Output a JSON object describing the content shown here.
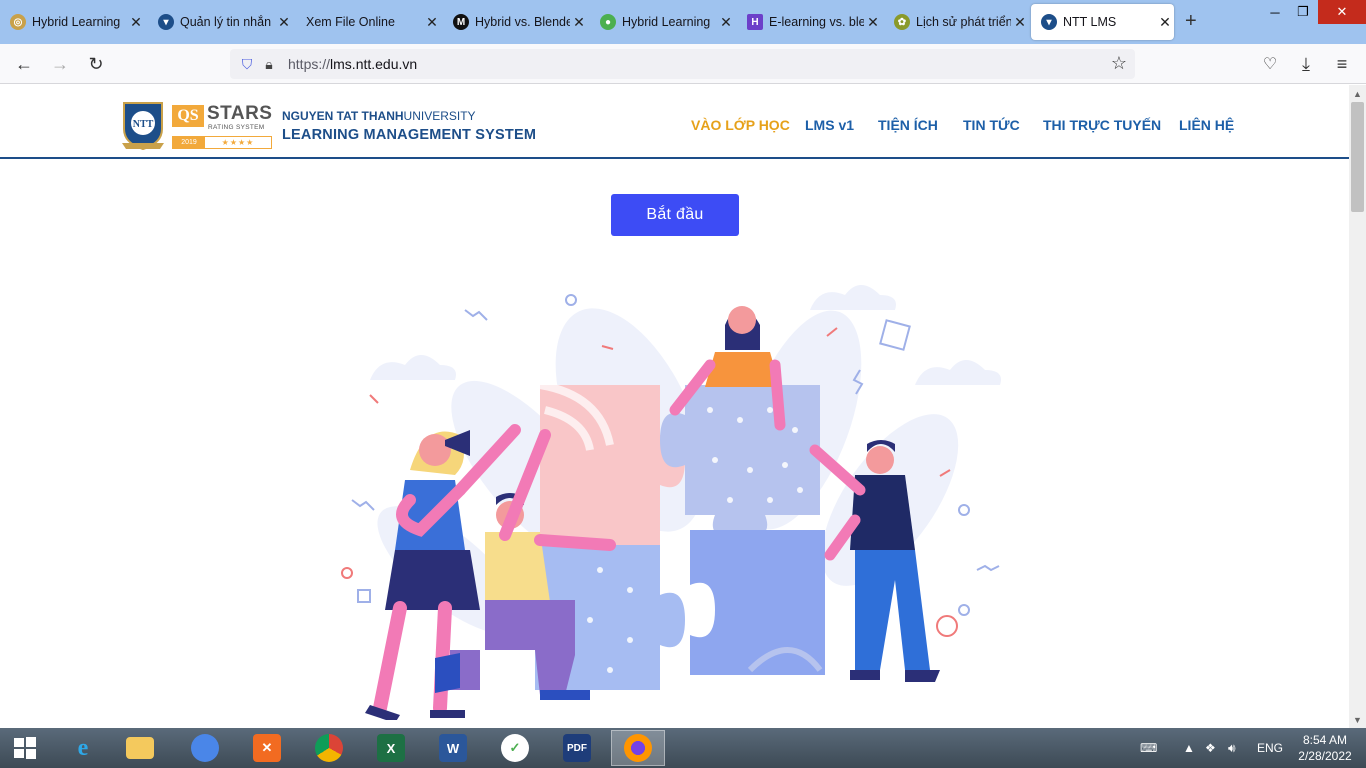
{
  "browser": {
    "tabs": [
      {
        "title": "Hybrid Learning",
        "icon": "globe-icon",
        "color": "#c9a14a"
      },
      {
        "title": "Quản lý tin nhắn",
        "icon": "ntt-shield-icon",
        "color": "#1d4e89"
      },
      {
        "title": "Xem File Online",
        "icon": "none",
        "color": ""
      },
      {
        "title": "Hybrid vs. Blended",
        "icon": "medium-icon",
        "color": "#111111"
      },
      {
        "title": "Hybrid Learning",
        "icon": "bulb-icon",
        "color": "#4caf50"
      },
      {
        "title": "E-learning vs. ble",
        "icon": "h-icon",
        "color": "#6c3fc9"
      },
      {
        "title": "Lịch sử phát triển",
        "icon": "seal-icon",
        "color": "#8a9a2a"
      },
      {
        "title": "NTT LMS",
        "icon": "ntt-shield-icon",
        "color": "#1d4e89"
      }
    ],
    "url": "https://lms.ntt.edu.vn",
    "url_host": "lms.ntt.edu.vn",
    "url_scheme": "https://"
  },
  "site": {
    "university": "NGUYEN TAT THANH",
    "university_suffix": "UNIVERSITY",
    "system": "LEARNING MANAGEMENT SYSTEM",
    "qs": {
      "q": "QS",
      "stars": "STARS",
      "rating": "RATING SYSTEM",
      "year": "2019",
      "star_row": "★★★★"
    },
    "logo_text": "NTT",
    "menu": [
      {
        "label": "VÀO LỚP HỌC",
        "active": true
      },
      {
        "label": "LMS v1",
        "active": false
      },
      {
        "label": "TIỆN ÍCH",
        "active": false
      },
      {
        "label": "TIN TỨC",
        "active": false
      },
      {
        "label": "THI TRỰC TUYẾN",
        "active": false
      },
      {
        "label": "LIÊN HỆ",
        "active": false
      }
    ],
    "start_button": "Bắt đầu"
  },
  "taskbar": {
    "apps": [
      "ie-icon",
      "file-explorer-icon",
      "chromium-icon",
      "xampp-icon",
      "chrome-icon",
      "excel-icon",
      "word-icon",
      "app-green-icon",
      "pdf-icon",
      "firefox-icon"
    ],
    "language": "ENG",
    "time": "8:54 AM",
    "date": "2/28/2022"
  },
  "colors": {
    "accent": "#3d4cf5",
    "brand": "#1d4e89",
    "menu_active": "#e6a11a"
  }
}
